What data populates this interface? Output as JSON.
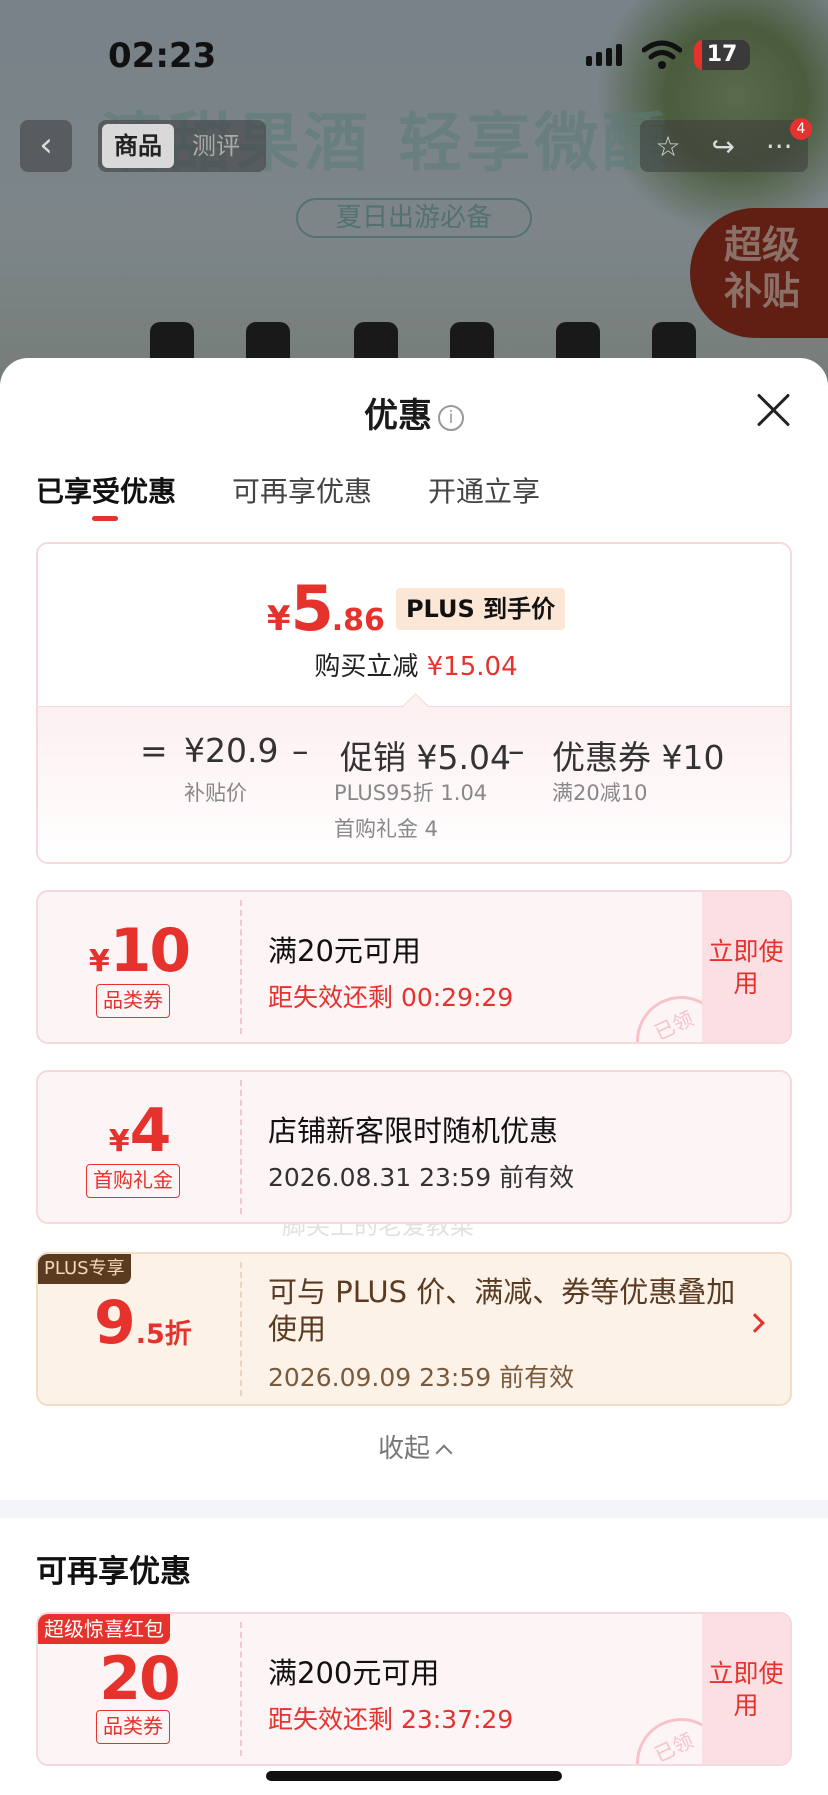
{
  "status_bar": {
    "time": "02:23",
    "battery": "17"
  },
  "background": {
    "headline": "清甜果酒 轻享微醺",
    "tagline": "夏日出游必备",
    "super_badge_line1": "超级",
    "super_badge_line2": "补贴",
    "nav": {
      "back": "‹",
      "tab_goods": "商品",
      "tab_review": "测评",
      "badge": "4"
    }
  },
  "sheet": {
    "title": "优惠",
    "info_icon": "i",
    "tabs": [
      "已享受优惠",
      "可再享优惠",
      "开通立享"
    ],
    "summary": {
      "yen": "¥",
      "price_int": "5",
      "price_dec": ".86",
      "plus_tag": "PLUS 到手价",
      "reduce_label": "购买立减",
      "reduce_amount": "¥15.04",
      "eq": "=",
      "minus": "–",
      "item1_value": "¥20.9",
      "item1_label": "补贴价",
      "item2_value": "促销 ¥5.04",
      "item2_label1": "PLUS95折 1.04",
      "item2_label2": "首购礼金 4",
      "item3_value": "优惠券 ¥10",
      "item3_label": "满20减10"
    },
    "watermark": "脚尖上的老爱教菜",
    "coupons": [
      {
        "yen": "¥",
        "amount": "10",
        "kind": "品类券",
        "title": "满20元可用",
        "sub": "距失效还剩 00:29:29",
        "button": "立即使用",
        "stamp": "已领"
      },
      {
        "yen": "¥",
        "amount": "4",
        "kind": "首购礼金",
        "title": "店铺新客限时随机优惠",
        "sub": "2026.08.31 23:59 前有效"
      }
    ],
    "plus_card": {
      "label": "PLUS专享",
      "big": "9",
      "small": ".5折",
      "title": "可与 PLUS 价、满减、券等优惠叠加使用",
      "sub": "2026.09.09 23:59 前有效"
    },
    "collapse": "收起",
    "section2_title": "可再享优惠",
    "coupon3": {
      "label": "超级惊喜红包",
      "amount": "20",
      "kind": "品类券",
      "title": "满200元可用",
      "sub": "距失效还剩 23:37:29",
      "button": "立即使用",
      "stamp": "已领"
    }
  }
}
